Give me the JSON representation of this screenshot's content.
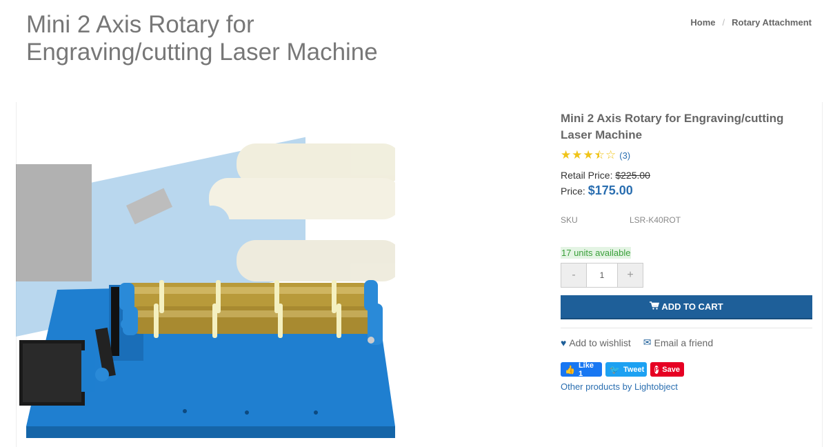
{
  "page": {
    "title": "Mini 2 Axis Rotary for Engraving/cutting Laser Machine"
  },
  "breadcrumb": {
    "items": [
      "Home",
      "Rotary Attachment"
    ],
    "separator": "/"
  },
  "product": {
    "name": "Mini 2 Axis Rotary for Engraving/cutting Laser Machine",
    "rating": 3.5,
    "rating_max": 5,
    "review_count": "(3)",
    "retail_label": "Retail Price:",
    "retail_value": "$225.00",
    "price_label": "Price:",
    "price_value": "$175.00",
    "sku_label": "SKU",
    "sku_value": "LSR-K40ROT",
    "stock": "17 units available",
    "qty_minus": "-",
    "qty_value": "1",
    "qty_plus": "+",
    "add_to_cart": "ADD TO CART",
    "wishlist": "Add to wishlist",
    "email_friend": "Email a friend",
    "other_products": "Other products by Lightobject"
  },
  "social": {
    "like": "Like 1",
    "tweet": "Tweet",
    "save": "Save"
  },
  "icons": {
    "cart": "shopping-cart-icon",
    "heart": "heart-icon",
    "envelope": "envelope-icon",
    "star_full": "star-full-icon",
    "star_half": "star-half-icon",
    "star_empty": "star-empty-icon"
  },
  "colors": {
    "accent": "#1e5f99",
    "link": "#2a6eb0",
    "star": "#f0c419",
    "stock_bg": "#e4f4e4",
    "stock_text": "#3aa03a",
    "facebook": "#1877f2",
    "twitter": "#1da1f2",
    "pinterest": "#e60023"
  }
}
